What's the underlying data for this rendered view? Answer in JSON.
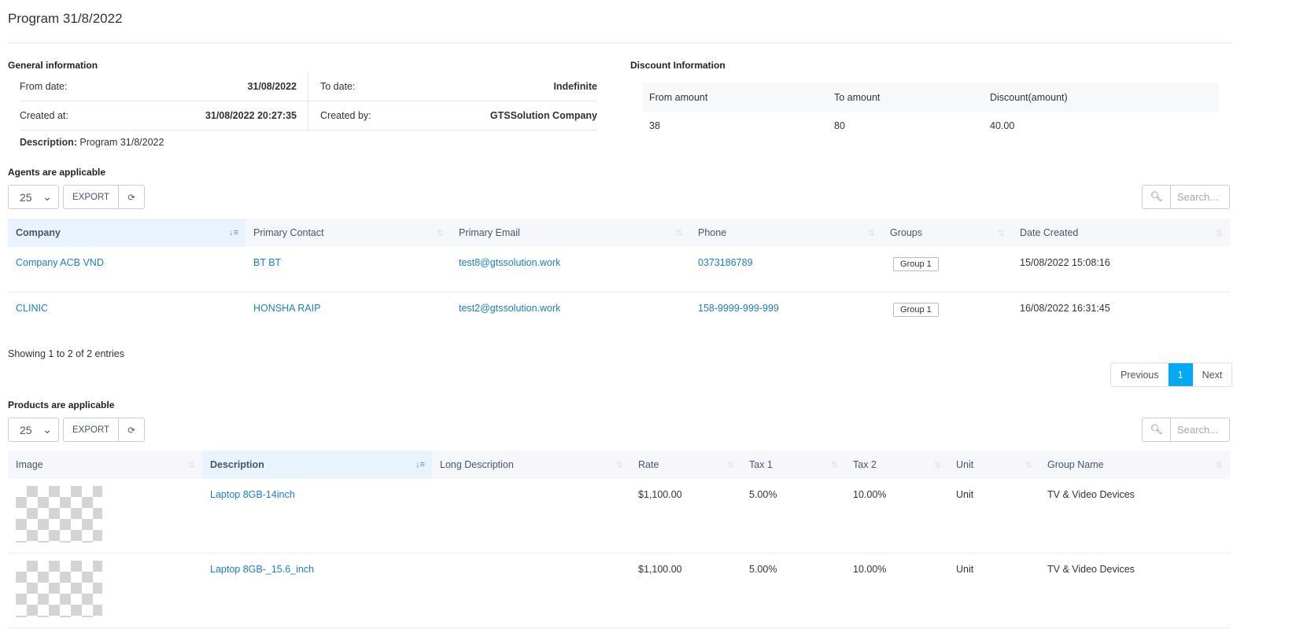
{
  "title": "Program 31/8/2022",
  "general": {
    "heading": "General information",
    "from_label": "From date:",
    "from_value": "31/08/2022",
    "to_label": "To date:",
    "to_value": "Indefinite",
    "created_at_label": "Created at:",
    "created_at_value": "31/08/2022 20:27:35",
    "created_by_label": "Created by:",
    "created_by_value": "GTSSolution Company",
    "desc_label": "Description:",
    "desc_value": "Program 31/8/2022"
  },
  "discount": {
    "heading": "Discount Information",
    "headers": [
      "From amount",
      "To amount",
      "Discount(amount)"
    ],
    "row": [
      "38",
      "80",
      "40.00"
    ]
  },
  "agents": {
    "heading": "Agents are applicable",
    "page_size": "25",
    "export": "EXPORT",
    "search_placeholder": "Search...",
    "headers": [
      "Company",
      "Primary Contact",
      "Primary Email",
      "Phone",
      "Groups",
      "Date Created"
    ],
    "rows": [
      [
        "Company ACB VND",
        "BT BT",
        "test8@gtssolution.work",
        "0373186789",
        "Group 1",
        "15/08/2022 15:08:16"
      ],
      [
        "CLINIC",
        "HONSHA RAIP",
        "test2@gtssolution.work",
        "158-9999-999-999",
        "Group 1",
        "16/08/2022 16:31:45"
      ]
    ],
    "info": "Showing 1 to 2 of 2 entries",
    "prev": "Previous",
    "page": "1",
    "next": "Next"
  },
  "products": {
    "heading": "Products are applicable",
    "page_size": "25",
    "export": "EXPORT",
    "search_placeholder": "Search...",
    "headers": [
      "Image",
      "Description",
      "Long Description",
      "Rate",
      "Tax 1",
      "Tax 2",
      "Unit",
      "Group Name"
    ],
    "rows": [
      [
        "",
        "Laptop 8GB-14inch",
        "",
        "$1,100.00",
        "5.00%",
        "10.00%",
        "Unit",
        "TV & Video Devices"
      ],
      [
        "",
        "Laptop 8GB-_15.6_inch",
        "",
        "$1,100.00",
        "5.00%",
        "10.00%",
        "Unit",
        "TV & Video Devices"
      ]
    ]
  }
}
